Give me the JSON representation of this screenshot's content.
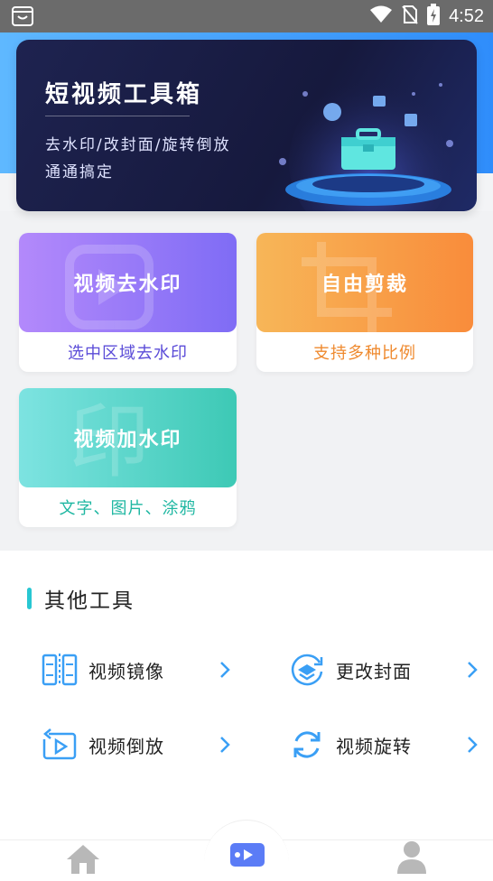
{
  "status_bar": {
    "time": "4:52"
  },
  "banner": {
    "title": "短视频工具箱",
    "line1": "去水印/改封面/旋转倒放",
    "line2": "通通搞定"
  },
  "features": [
    {
      "title": "视频去水印",
      "subtitle": "选中区域去水印"
    },
    {
      "title": "自由剪裁",
      "subtitle": "支持多种比例"
    },
    {
      "title": "视频加水印",
      "subtitle": "文字、图片、涂鸦",
      "ghost_glyph": "印"
    }
  ],
  "other_tools": {
    "heading": "其他工具",
    "items": [
      {
        "label": "视频镜像",
        "icon": "mirror-icon"
      },
      {
        "label": "更改封面",
        "icon": "cover-icon"
      },
      {
        "label": "视频倒放",
        "icon": "reverse-play-icon"
      },
      {
        "label": "视频旋转",
        "icon": "rotate-icon"
      }
    ]
  },
  "bottom_nav": [
    {
      "name": "home",
      "icon": "home-icon"
    },
    {
      "name": "video",
      "icon": "video-icon",
      "active": true
    },
    {
      "name": "profile",
      "icon": "user-icon"
    }
  ],
  "colors": {
    "accent": "#28c7d2",
    "purple": "#7f6cf5",
    "orange": "#f98c3b",
    "teal": "#3dc9b5",
    "banner_bg": "#16193d"
  }
}
